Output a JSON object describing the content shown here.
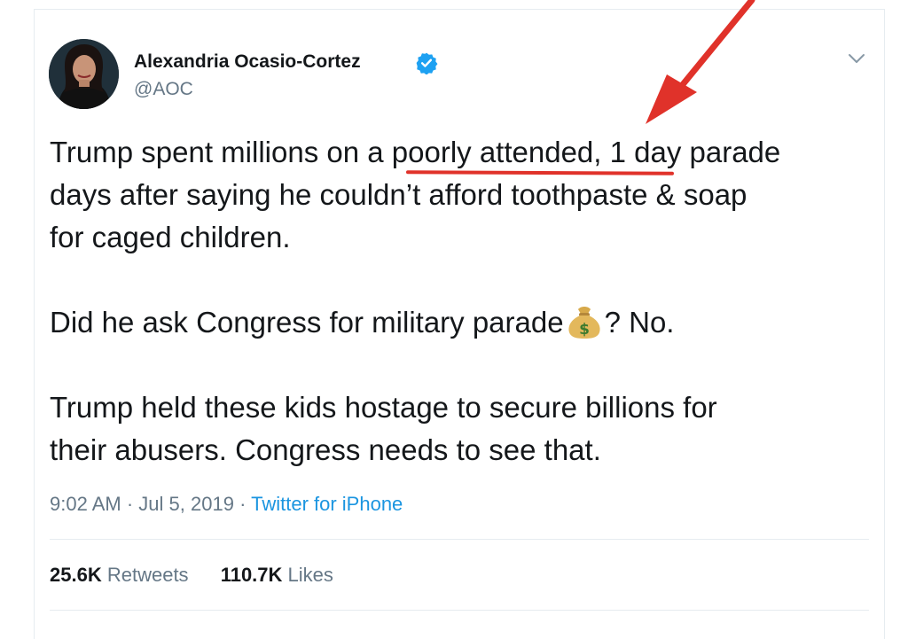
{
  "tweet": {
    "author_name": "Alexandria Ocasio-Cortez",
    "author_handle": "@AOC",
    "lines": [
      "Trump spent millions on a poorly attended, 1 day parade",
      "days after saying he couldn’t afford toothpaste & soap",
      "for caged children."
    ],
    "line4_before_emoji": "Did he ask Congress for military parade",
    "emoji_name": "money-bag-icon",
    "line4_after_emoji": "? No.",
    "lines_end": [
      "Trump held these kids hostage to secure billions for",
      "their abusers. Congress needs to see that."
    ],
    "time": "9:02 AM",
    "separator": "·",
    "date": "Jul 5, 2019",
    "source": "Twitter for iPhone"
  },
  "stats": {
    "retweets_count": "25.6K",
    "retweets_label": "Retweets",
    "likes_count": "110.7K",
    "likes_label": "Likes"
  },
  "colors": {
    "annotation_red": "#e0322a",
    "link_blue": "#1b95e0",
    "secondary_gray": "#657786"
  }
}
